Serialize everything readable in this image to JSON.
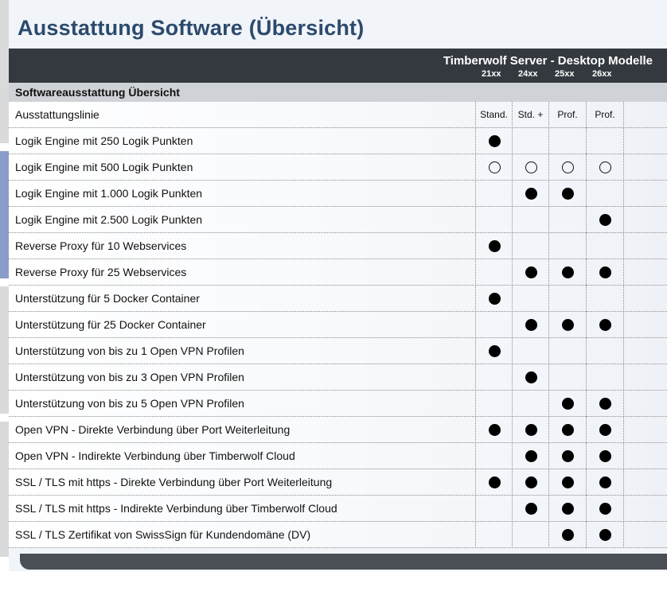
{
  "title": "Ausstattung Software (Übersicht)",
  "header": {
    "product": "Timberwolf Server - Desktop Modelle",
    "models": [
      "21xx",
      "24xx",
      "25xx",
      "26xx"
    ]
  },
  "section": "Softwareausstattung Übersicht",
  "row_header": {
    "label": "Ausstattungslinie",
    "columns": [
      "Stand.",
      "Std. +",
      "Prof.",
      "Prof."
    ]
  },
  "rows": [
    {
      "label": "Logik Engine mit 250 Logik Punkten",
      "marks": [
        "full",
        "",
        "",
        ""
      ]
    },
    {
      "label": "Logik Engine mit 500 Logik Punkten",
      "marks": [
        "open",
        "open",
        "open",
        "open"
      ]
    },
    {
      "label": "Logik Engine mit 1.000 Logik Punkten",
      "marks": [
        "",
        "full",
        "full",
        ""
      ]
    },
    {
      "label": "Logik Engine mit 2.500 Logik Punkten",
      "marks": [
        "",
        "",
        "",
        "full"
      ]
    },
    {
      "label": "Reverse Proxy für 10 Webservices",
      "marks": [
        "full",
        "",
        "",
        ""
      ]
    },
    {
      "label": "Reverse Proxy für 25 Webservices",
      "marks": [
        "",
        "full",
        "full",
        "full"
      ]
    },
    {
      "label": "Unterstützung für 5 Docker Container",
      "marks": [
        "full",
        "",
        "",
        ""
      ]
    },
    {
      "label": "Unterstützung für 25 Docker Container",
      "marks": [
        "",
        "full",
        "full",
        "full"
      ]
    },
    {
      "label": "Unterstützung von bis zu 1 Open VPN Profilen",
      "marks": [
        "full",
        "",
        "",
        ""
      ]
    },
    {
      "label": "Unterstützung von bis zu 3 Open VPN Profilen",
      "marks": [
        "",
        "full",
        "",
        ""
      ]
    },
    {
      "label": "Unterstützung von bis zu 5 Open VPN Profilen",
      "marks": [
        "",
        "",
        "full",
        "full"
      ]
    },
    {
      "label": "Open VPN - Direkte Verbindung über Port Weiterleitung",
      "marks": [
        "full",
        "full",
        "full",
        "full"
      ]
    },
    {
      "label": "Open VPN - Indirekte Verbindung über Timberwolf Cloud",
      "marks": [
        "",
        "full",
        "full",
        "full"
      ]
    },
    {
      "label": "SSL / TLS mit https - Direkte Verbindung über Port Weiterleitung",
      "marks": [
        "full",
        "full",
        "full",
        "full"
      ]
    },
    {
      "label": "SSL / TLS mit https - Indirekte Verbindung über Timberwolf Cloud",
      "marks": [
        "",
        "full",
        "full",
        "full"
      ]
    },
    {
      "label": "SSL / TLS Zertifikat von SwissSign für Kundendomäne (DV)",
      "marks": [
        "",
        "",
        "full",
        "full"
      ]
    }
  ]
}
